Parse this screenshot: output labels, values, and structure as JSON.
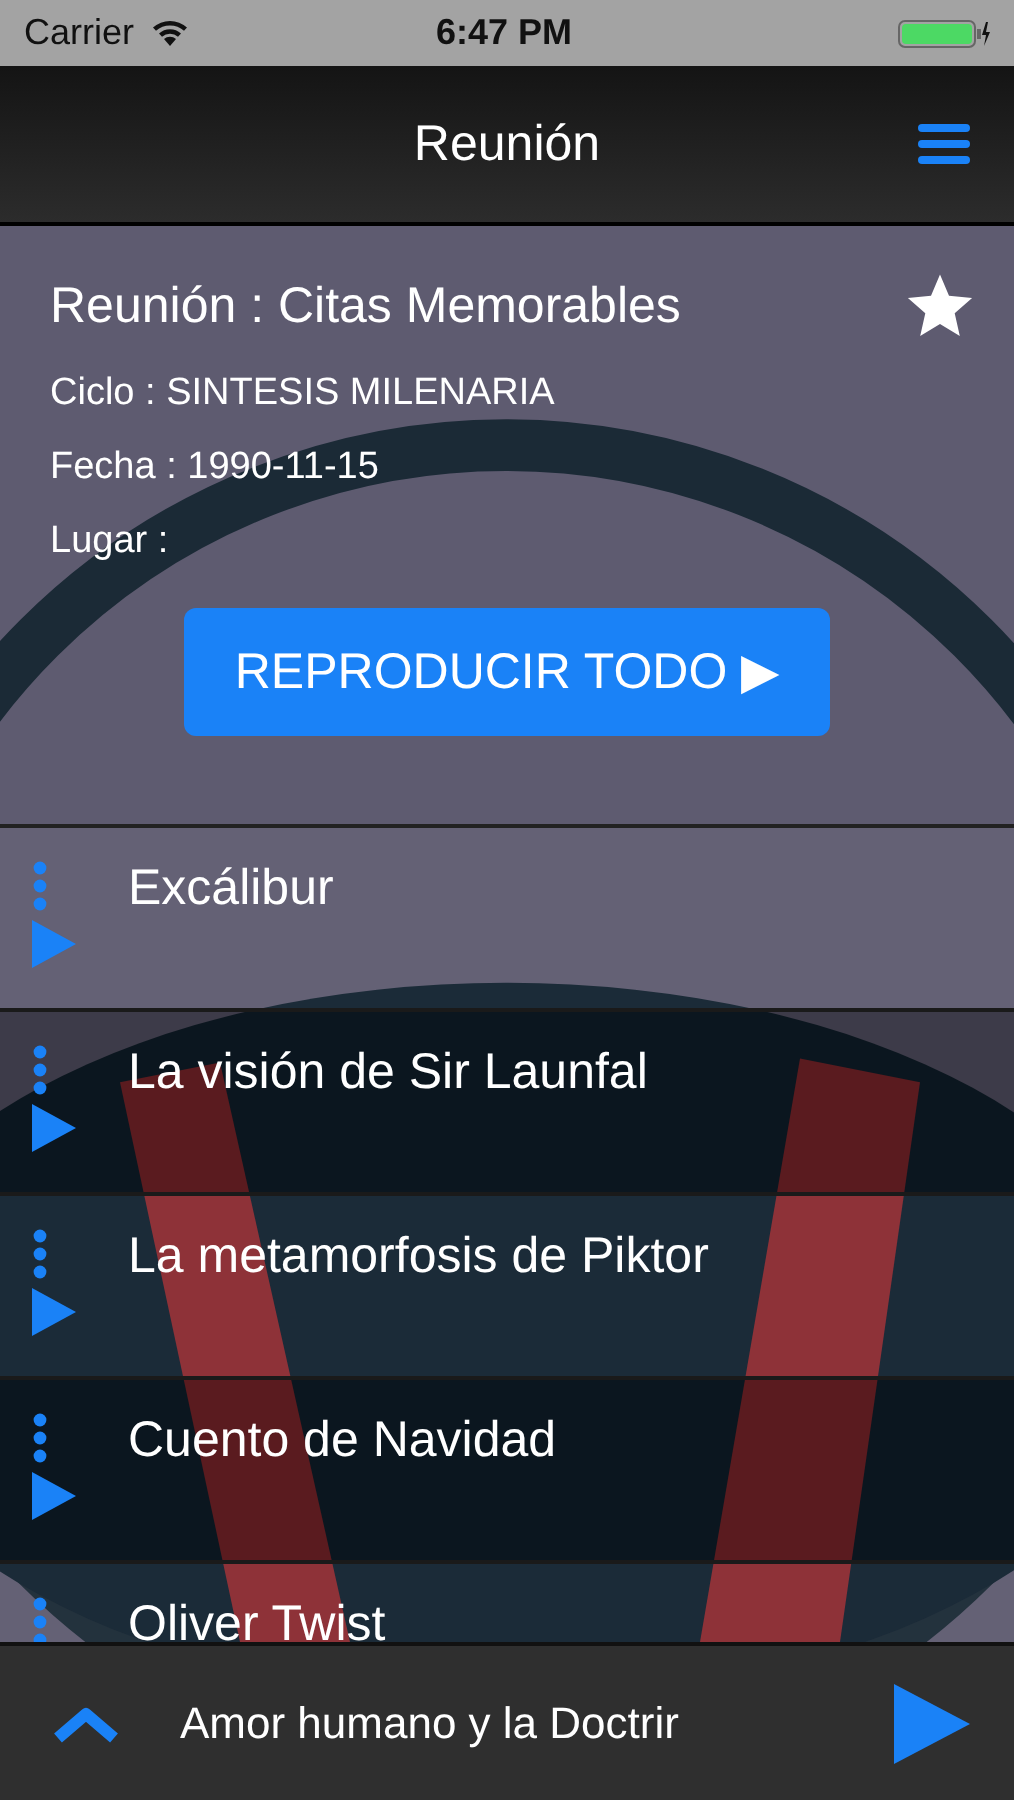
{
  "status_bar": {
    "carrier": "Carrier",
    "time": "6:47 PM"
  },
  "nav": {
    "title": "Reunión"
  },
  "header": {
    "title": "Reunión : Citas Memorables",
    "fields": [
      "Ciclo : SINTESIS MILENARIA",
      "Fecha : 1990-11-15",
      "Lugar :"
    ],
    "play_all": "REPRODUCIR TODO ▶"
  },
  "tracks": [
    {
      "title": "Excálibur"
    },
    {
      "title": "La visión de Sir Launfal"
    },
    {
      "title": "La metamorfosis de Piktor"
    },
    {
      "title": "Cuento de Navidad"
    },
    {
      "title": "Oliver Twist"
    }
  ],
  "player": {
    "title": "Amor humano y la Doctrir"
  }
}
